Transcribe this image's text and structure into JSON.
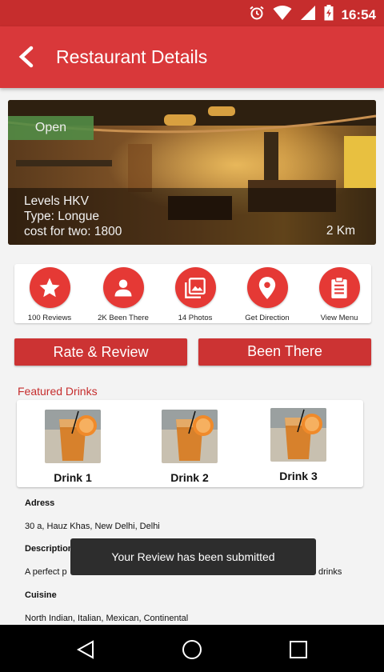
{
  "status_bar": {
    "time": "16:54",
    "icons": [
      "alarm-icon",
      "wifi-icon",
      "signal-icon",
      "battery-charging-icon"
    ]
  },
  "app_bar": {
    "title": "Restaurant Details",
    "back_icon": "back-arrow-icon"
  },
  "restaurant": {
    "status_badge": "Open",
    "name": "Levels HKV",
    "type": "Type: Longue",
    "cost": "cost for two: 1800",
    "distance": "2 Km"
  },
  "quick_actions": [
    {
      "label": "100 Reviews",
      "icon": "star-icon"
    },
    {
      "label": "2K Been There",
      "icon": "person-icon"
    },
    {
      "label": "14 Photos",
      "icon": "photos-icon"
    },
    {
      "label": "Get Direction",
      "icon": "location-pin-icon"
    },
    {
      "label": "View Menu",
      "icon": "clipboard-icon"
    }
  ],
  "buttons": {
    "rate_review": "Rate & Review",
    "been_there": "Been There"
  },
  "featured": {
    "title": "Featured Drinks",
    "drinks": [
      {
        "name": "Drink 1"
      },
      {
        "name": "Drink 2"
      },
      {
        "name": "Drink 3"
      }
    ]
  },
  "details": {
    "address_label": "Adress",
    "address_value": "30 a, Hauz Khas, New Delhi, Delhi",
    "description_label": "Description",
    "description_value_start": "A perfect p",
    "description_value_end": "drinks",
    "cuisine_label": "Cuisine",
    "cuisine_value": "North Indian, Italian, Mexican, Continental"
  },
  "toast": {
    "message": "Your Review has been submitted"
  },
  "colors": {
    "primary": "#d9383a",
    "status_bar": "#c62d2d",
    "accent": "#e53935",
    "open_badge": "#528c46"
  }
}
